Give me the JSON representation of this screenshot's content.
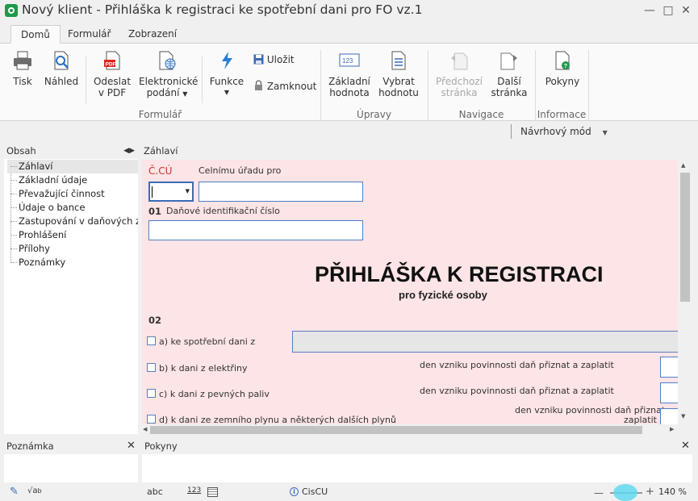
{
  "window": {
    "title": "Nový klient - Přihláška k registraci ke spotřební dani pro FO vz.1"
  },
  "ribbon": {
    "tabs": [
      "Domů",
      "Formulář",
      "Zobrazení"
    ],
    "buttons": {
      "tisk": "Tisk",
      "nahled": "Náhled",
      "odeslat_1": "Odeslat",
      "odeslat_2": "v PDF",
      "el_1": "Elektronické",
      "el_2": "podání",
      "funkce": "Funkce",
      "ulozit": "Uložit",
      "zamknout": "Zamknout",
      "zakl_1": "Základní",
      "zakl_2": "hodnota",
      "vybrat_1": "Vybrat",
      "vybrat_2": "hodnotu",
      "predchozi_1": "Předchozí",
      "predchozi_2": "stránka",
      "dalsi_1": "Další",
      "dalsi_2": "stránka",
      "pokyny": "Pokyny"
    },
    "groups": {
      "formular": "Formulář",
      "upravy": "Úpravy",
      "navigace": "Navigace",
      "informace": "Informace"
    },
    "mode": "Návrhový mód"
  },
  "sidebar": {
    "title": "Obsah",
    "items": [
      "Záhlaví",
      "Základní údaje",
      "Převažující činnost",
      "Údaje o bance",
      "Zastupování v daňových záležitostech",
      "Prohlášení",
      "Přílohy",
      "Poznámky"
    ]
  },
  "main": {
    "header": "Záhlaví",
    "form": {
      "cu_label": "Č.CÚ",
      "urad_label": "Celnímu úřadu pro",
      "sec01_num": "01",
      "sec01_label": "Daňové identifikační číslo",
      "title": "PŘIHLÁŠKA K REGISTRACI",
      "subtitle": "pro fyzické osoby",
      "sec02_num": "02",
      "opt_a": "a) ke spotřební dani z",
      "opt_b": "b) k dani z elektřiny",
      "opt_c": "c) k dani z pevných paliv",
      "opt_d": "d) k dani ze zemního plynu a některých dalších plynů",
      "den_text": "den vzniku povinnosti daň přiznat a zaplatit",
      "den_text_d1": "den vzniku povinnosti daň přiznat a",
      "den_text_d2": "zaplatit"
    }
  },
  "bottom": {
    "poznamka": "Poznámka",
    "pokyny": "Pokyny"
  },
  "status": {
    "abc": "abc",
    "num": "123",
    "cu": "CisCU",
    "zoom": "140 %"
  }
}
